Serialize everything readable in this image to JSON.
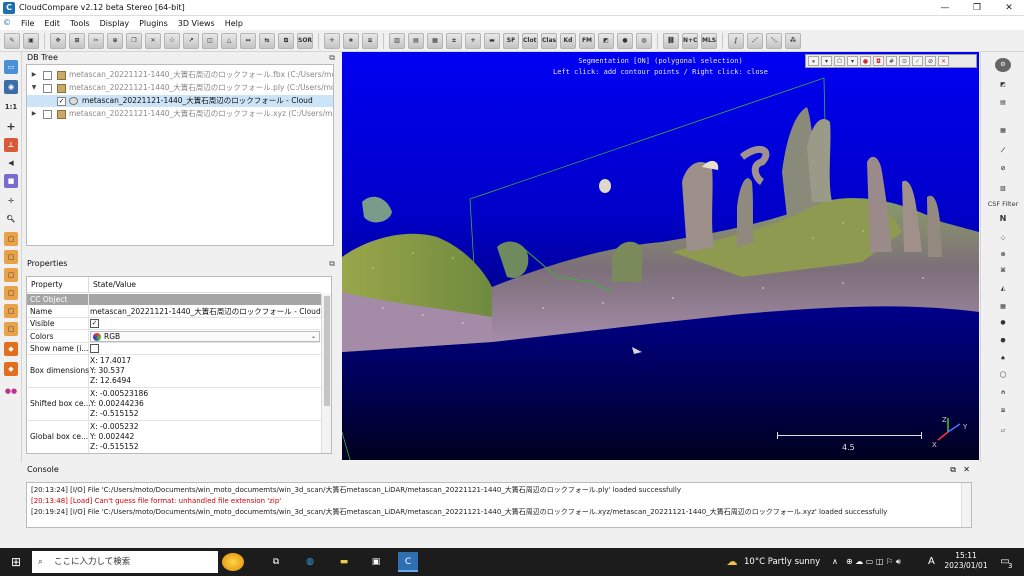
{
  "window": {
    "title": "CloudCompare v2.12 beta Stereo [64-bit]",
    "minimize": "—",
    "maximize": "❐",
    "close": "✕"
  },
  "menu": [
    "File",
    "Edit",
    "Tools",
    "Display",
    "Plugins",
    "3D Views",
    "Help"
  ],
  "toolbar": {
    "sor_label": "SOR",
    "sf_label": "SF",
    "cloth_label": "Cloth",
    "classify_label": "Classify",
    "kd_label": "Kd",
    "fm_label": "FM",
    "mls_label": "MLS",
    "n_c_label": "N+C"
  },
  "db_tree": {
    "title": "DB Tree",
    "items": [
      {
        "label": "metascan_20221121-1440_大簀石周辺のロックフォール.fbx (C:/Users/moto/...",
        "expanded": false,
        "checked": false
      },
      {
        "label": "metascan_20221121-1440_大簀石周辺のロックフォール.ply (C:/Users/moto/...",
        "expanded": true,
        "checked": false
      },
      {
        "label": "metascan_20221121-1440_大簀石周辺のロックフォール - Cloud",
        "expanded": false,
        "checked": true,
        "selected": true
      },
      {
        "label": "metascan_20221121-1440_大簀石周辺のロックフォール.xyz (C:/Users/moto/...",
        "expanded": false,
        "checked": false
      }
    ]
  },
  "properties": {
    "title": "Properties",
    "col_property": "Property",
    "col_value": "State/Value",
    "section": "CC Object",
    "name_key": "Name",
    "name_val": "metascan_20221121-1440_大簀石周辺のロックフォール - Cloud",
    "visible_key": "Visible",
    "colors_key": "Colors",
    "colors_val": "RGB",
    "showname_key": "Show name (i...",
    "box_key": "Box dimensions",
    "box": [
      "X: 17.4017",
      "Y: 30.537",
      "Z: 12.6494"
    ],
    "shifted_key": "Shifted box ce...",
    "shifted": [
      "X: -0.00523186",
      "Y: 0.00244236",
      "Z: -0.515152"
    ],
    "global_key": "Global box ce...",
    "global": [
      "X: -0.005232",
      "Y: 0.002442",
      "Z: -0.515152"
    ]
  },
  "viewport": {
    "segmentation_line1": "Segmentation [ON] (polygonal selection)",
    "segmentation_line2": "Left click: add contour points / Right click: close",
    "scale_value": "4.5",
    "axis_z": "Z",
    "axis_y": "Y",
    "axis_x": "X",
    "colors": {
      "sky_top": "#0000f2",
      "sky_bottom": "#000020",
      "polyline": "#3fae3f"
    }
  },
  "right_toolbar": {
    "csf_label": "CSF Filter",
    "n_label": "N"
  },
  "console": {
    "title": "Console",
    "lines": [
      {
        "text": "[20:13:24] [I/O] File 'C:/Users/moto/Documents/win_moto_documemts/win_3d_scan/大簀石metascan_LiDAR/metascan_20221121-1440_大簀石周辺のロックフォール.ply' loaded successfully",
        "error": false
      },
      {
        "text": "[20:13:48] [Load] Can't guess file format: unhandled file extension 'zip'",
        "error": true
      },
      {
        "text": "[20:19:24] [I/O] File 'C:/Users/moto/Documents/win_moto_documemts/win_3d_scan/大簀石metascan_LiDAR/metascan_20221121-1440_大簀石周辺のロックフォール.xyz/metascan_20221121-1440_大簀石周辺のロックフォール.xyz' loaded successfully",
        "error": false
      }
    ]
  },
  "taskbar": {
    "search_placeholder": "ここに入力して検索",
    "weather": "10°C  Partly sunny",
    "ime": "A",
    "time": "15:11",
    "date": "2023/01/01",
    "notification_count": "3",
    "colors": {
      "bg": "#1c1c1c"
    }
  }
}
